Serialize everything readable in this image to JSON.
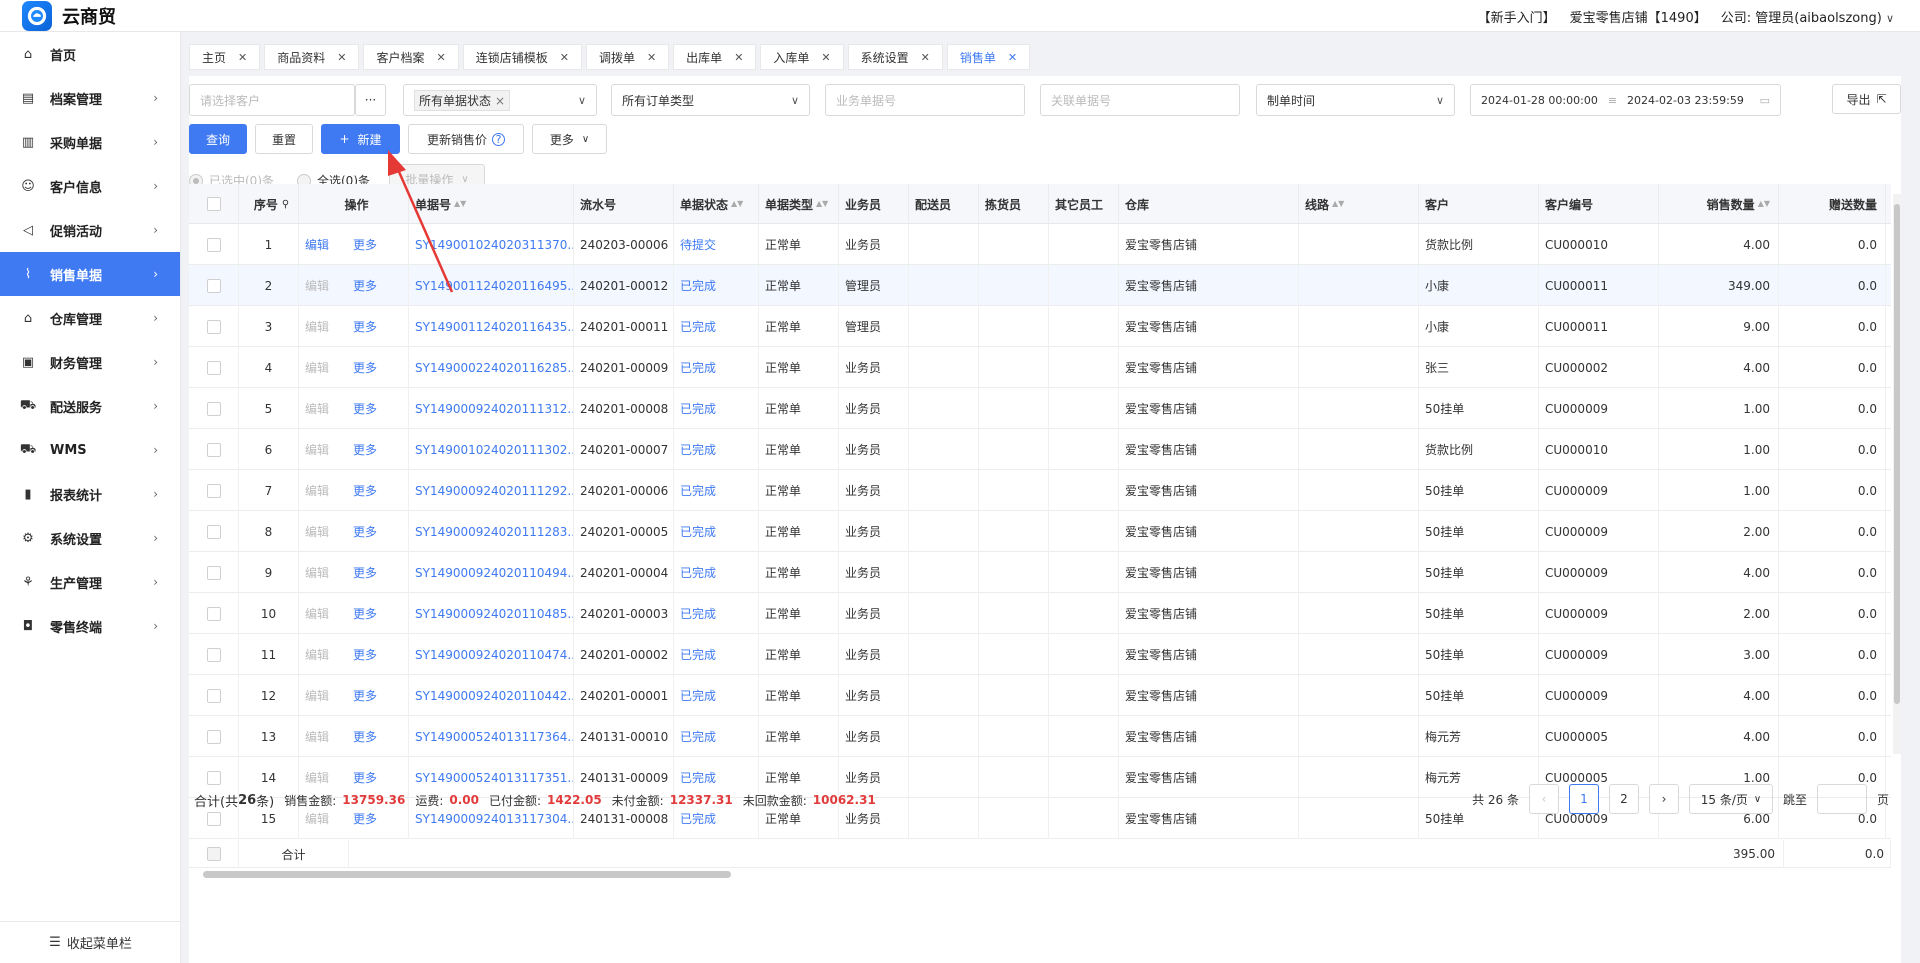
{
  "app": {
    "title": "云商贸"
  },
  "header": {
    "guide": "【新手入门】",
    "store": "爱宝零售店铺【1490】",
    "company": "公司: 管理员(aibaolszong)"
  },
  "sidebar": {
    "items": [
      {
        "label": "首页",
        "icon": "home-icon"
      },
      {
        "label": "档案管理",
        "icon": "archive-icon"
      },
      {
        "label": "采购单据",
        "icon": "purchase-doc-icon"
      },
      {
        "label": "客户信息",
        "icon": "user-icon"
      },
      {
        "label": "促销活动",
        "icon": "megaphone-icon"
      },
      {
        "label": "销售单据",
        "icon": "chart-line-icon"
      },
      {
        "label": "仓库管理",
        "icon": "warehouse-icon"
      },
      {
        "label": "财务管理",
        "icon": "finance-icon"
      },
      {
        "label": "配送服务",
        "icon": "cart-icon"
      },
      {
        "label": "WMS",
        "icon": "truck-icon"
      },
      {
        "label": "报表统计",
        "icon": "bar-chart-icon"
      },
      {
        "label": "系统设置",
        "icon": "gear-icon"
      },
      {
        "label": "生产管理",
        "icon": "production-icon"
      },
      {
        "label": "零售终端",
        "icon": "bag-icon"
      }
    ],
    "active_index": 5,
    "collapse_label": "收起菜单栏"
  },
  "tabs": [
    {
      "label": "主页"
    },
    {
      "label": "商品资料"
    },
    {
      "label": "客户档案"
    },
    {
      "label": "连锁店铺模板"
    },
    {
      "label": "调拨单"
    },
    {
      "label": "出库单"
    },
    {
      "label": "入库单"
    },
    {
      "label": "系统设置"
    },
    {
      "label": "销售单"
    }
  ],
  "filters": {
    "customer_placeholder": "请选择客户",
    "customer_more": "···",
    "status_tag": "所有单据状态",
    "order_type": "所有订单类型",
    "biz_no_placeholder": "业务单据号",
    "related_no_placeholder": "关联单据号",
    "time_field": "制单时间",
    "date_start": "2024-01-28 00:00:00",
    "date_sep": "≡",
    "date_end": "2024-02-03 23:59:59",
    "export": "导出"
  },
  "actions": {
    "query": "查询",
    "reset": "重置",
    "new": "新建",
    "update_price": "更新销售价",
    "more": "更多",
    "selected": "已选中(0)条",
    "select_all": "全选(0)条",
    "batch": "批量操作"
  },
  "table": {
    "headers": [
      "序号",
      "操作",
      "单据号",
      "流水号",
      "单据状态",
      "单据类型",
      "业务员",
      "配送员",
      "拣货员",
      "其它员工",
      "仓库",
      "线路",
      "客户",
      "客户编号",
      "销售数量",
      "赠送数量"
    ],
    "op_edit": "编辑",
    "op_more": "更多",
    "rows": [
      {
        "no": "1",
        "doc": "SY149001024020311370...",
        "serial": "240203-00006",
        "status": "待提交",
        "type": "正常单",
        "sales": "业务员",
        "warehouse": "爱宝零售店铺",
        "customer": "货款比例",
        "cust_no": "CU000010",
        "qty": "4.00",
        "gift": "0.0"
      },
      {
        "no": "2",
        "doc": "SY149001124020116495...",
        "serial": "240201-00012",
        "status": "已完成",
        "type": "正常单",
        "sales": "管理员",
        "warehouse": "爱宝零售店铺",
        "customer": "小康",
        "cust_no": "CU000011",
        "qty": "349.00",
        "gift": "0.0"
      },
      {
        "no": "3",
        "doc": "SY149001124020116435...",
        "serial": "240201-00011",
        "status": "已完成",
        "type": "正常单",
        "sales": "管理员",
        "warehouse": "爱宝零售店铺",
        "customer": "小康",
        "cust_no": "CU000011",
        "qty": "9.00",
        "gift": "0.0"
      },
      {
        "no": "4",
        "doc": "SY149000224020116285...",
        "serial": "240201-00009",
        "status": "已完成",
        "type": "正常单",
        "sales": "业务员",
        "warehouse": "爱宝零售店铺",
        "customer": "张三",
        "cust_no": "CU000002",
        "qty": "4.00",
        "gift": "0.0"
      },
      {
        "no": "5",
        "doc": "SY149000924020111312...",
        "serial": "240201-00008",
        "status": "已完成",
        "type": "正常单",
        "sales": "业务员",
        "warehouse": "爱宝零售店铺",
        "customer": "50挂单",
        "cust_no": "CU000009",
        "qty": "1.00",
        "gift": "0.0"
      },
      {
        "no": "6",
        "doc": "SY149001024020111302...",
        "serial": "240201-00007",
        "status": "已完成",
        "type": "正常单",
        "sales": "业务员",
        "warehouse": "爱宝零售店铺",
        "customer": "货款比例",
        "cust_no": "CU000010",
        "qty": "1.00",
        "gift": "0.0"
      },
      {
        "no": "7",
        "doc": "SY149000924020111292...",
        "serial": "240201-00006",
        "status": "已完成",
        "type": "正常单",
        "sales": "业务员",
        "warehouse": "爱宝零售店铺",
        "customer": "50挂单",
        "cust_no": "CU000009",
        "qty": "1.00",
        "gift": "0.0"
      },
      {
        "no": "8",
        "doc": "SY149000924020111283...",
        "serial": "240201-00005",
        "status": "已完成",
        "type": "正常单",
        "sales": "业务员",
        "warehouse": "爱宝零售店铺",
        "customer": "50挂单",
        "cust_no": "CU000009",
        "qty": "2.00",
        "gift": "0.0"
      },
      {
        "no": "9",
        "doc": "SY149000924020110494...",
        "serial": "240201-00004",
        "status": "已完成",
        "type": "正常单",
        "sales": "业务员",
        "warehouse": "爱宝零售店铺",
        "customer": "50挂单",
        "cust_no": "CU000009",
        "qty": "4.00",
        "gift": "0.0"
      },
      {
        "no": "10",
        "doc": "SY149000924020110485...",
        "serial": "240201-00003",
        "status": "已完成",
        "type": "正常单",
        "sales": "业务员",
        "warehouse": "爱宝零售店铺",
        "customer": "50挂单",
        "cust_no": "CU000009",
        "qty": "2.00",
        "gift": "0.0"
      },
      {
        "no": "11",
        "doc": "SY149000924020110474...",
        "serial": "240201-00002",
        "status": "已完成",
        "type": "正常单",
        "sales": "业务员",
        "warehouse": "爱宝零售店铺",
        "customer": "50挂单",
        "cust_no": "CU000009",
        "qty": "3.00",
        "gift": "0.0"
      },
      {
        "no": "12",
        "doc": "SY149000924020110442...",
        "serial": "240201-00001",
        "status": "已完成",
        "type": "正常单",
        "sales": "业务员",
        "warehouse": "爱宝零售店铺",
        "customer": "50挂单",
        "cust_no": "CU000009",
        "qty": "4.00",
        "gift": "0.0"
      },
      {
        "no": "13",
        "doc": "SY149000524013117364...",
        "serial": "240131-00010",
        "status": "已完成",
        "type": "正常单",
        "sales": "业务员",
        "warehouse": "爱宝零售店铺",
        "customer": "梅元芳",
        "cust_no": "CU000005",
        "qty": "4.00",
        "gift": "0.0"
      },
      {
        "no": "14",
        "doc": "SY149000524013117351...",
        "serial": "240131-00009",
        "status": "已完成",
        "type": "正常单",
        "sales": "业务员",
        "warehouse": "爱宝零售店铺",
        "customer": "梅元芳",
        "cust_no": "CU000005",
        "qty": "1.00",
        "gift": "0.0"
      },
      {
        "no": "15",
        "doc": "SY149000924013117304...",
        "serial": "240131-00008",
        "status": "已完成",
        "type": "正常单",
        "sales": "业务员",
        "warehouse": "爱宝零售店铺",
        "customer": "50挂单",
        "cust_no": "CU000009",
        "qty": "6.00",
        "gift": "0.0"
      }
    ],
    "sum_label": "合计",
    "sum_qty": "395.00",
    "sum_gift": "0.0"
  },
  "footer": {
    "total_label": "合计(共",
    "total_count": "26",
    "total_suffix": "条)",
    "sales_amount_label": "销售金额:",
    "sales_amount": "13759.36",
    "freight_label": "运费:",
    "freight": "0.00",
    "paid_label": "已付金额:",
    "paid": "1422.05",
    "unpaid_label": "未付金额:",
    "unpaid": "12337.31",
    "uncollected_label": "未回款金额:",
    "uncollected": "10062.31"
  },
  "pagination": {
    "total": "共 26 条",
    "pages": [
      "1",
      "2"
    ],
    "page_size": "15 条/页",
    "jump_label": "跳至",
    "page_unit": "页"
  },
  "colors": {
    "accent": "#3f7af2",
    "amount": "#e23b3b",
    "annotation": "#e53935"
  }
}
